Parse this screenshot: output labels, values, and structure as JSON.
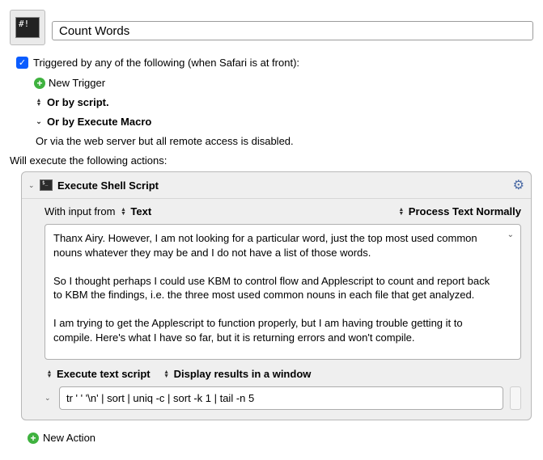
{
  "header": {
    "icon_text": "#!",
    "title": "Count Words"
  },
  "trigger_section": {
    "checkbox_label": "Triggered by any of the following (when Safari is at front):",
    "new_trigger": "New Trigger",
    "or_by_script": "Or by script.",
    "or_by_execute_macro": "Or by Execute Macro",
    "or_via_web": "Or via the web server but all remote access is disabled."
  },
  "exec_label": "Will execute the following actions:",
  "action": {
    "title": "Execute Shell Script",
    "with_input_from": "With input from",
    "input_mode": "Text",
    "process_mode": "Process Text Normally",
    "body_text": "Thanx Airy. However, I am not looking for a particular word, just the top most used common nouns whatever they may be and I do not have a list of those words.\n\nSo I thought perhaps I could use KBM to control flow and Applescript to count and report back to KBM the findings, i.e. the three most used common nouns in each file that get analyzed.\n\nI am trying to get the Applescript to function properly, but I am having trouble getting it to compile. Here's what I have so far, but it is returning errors and won't compile.",
    "execute_option": "Execute text script",
    "display_option": "Display results in a window",
    "script_text": "tr ' ' '\\n' | sort | uniq -c | sort -k 1 | tail -n 5"
  },
  "new_action_label": "New Action"
}
